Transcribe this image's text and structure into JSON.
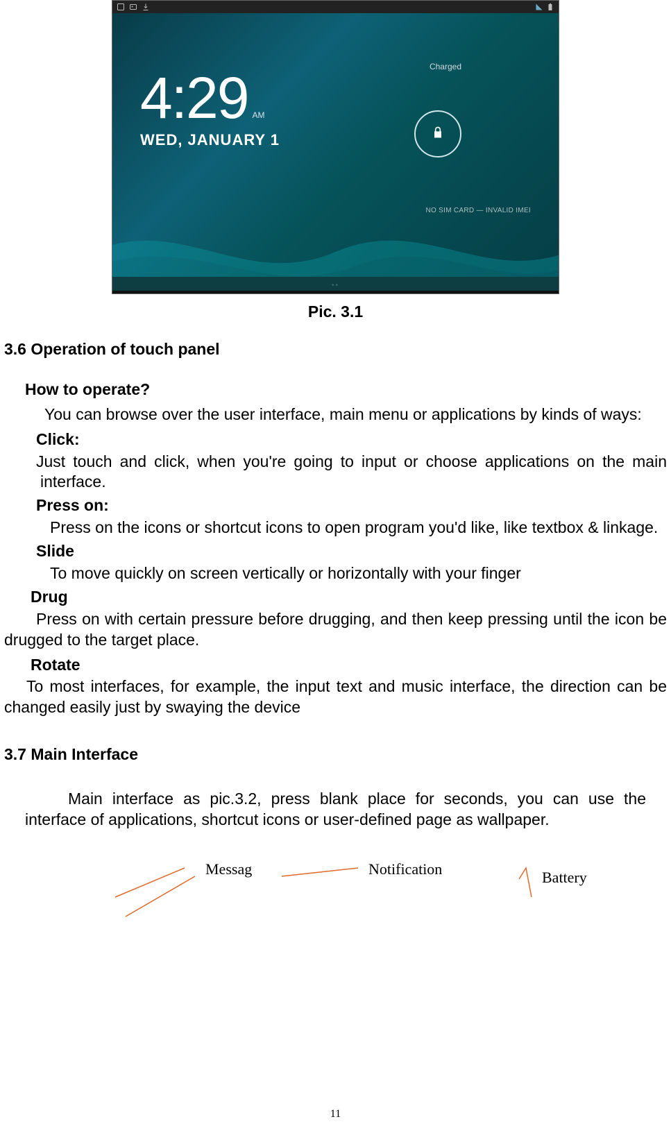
{
  "tablet": {
    "time": "4:29",
    "ampm": "AM",
    "date": "WED, JANUARY 1",
    "charged": "Charged",
    "sim_status": "NO SIM CARD — INVALID IMEI",
    "caption": "Pic. 3.1"
  },
  "section36": {
    "title": "3.6 Operation of touch panel",
    "howto": "How to operate?",
    "intro": "You can browse over the user interface, main menu or applications by kinds of ways:",
    "click_h": "Click:",
    "click_b": "Just touch and click, when you're going to input or choose applications on the main interface.",
    "press_h": "Press on:",
    "press_b": "Press on the icons or shortcut icons to open program you'd like, like textbox & linkage.",
    "slide_h": "Slide",
    "slide_b": "To move quickly on screen vertically or horizontally with your finger",
    "drug_h": "Drug",
    "drug_b": "Press on with certain pressure before drugging, and then keep pressing until the icon be drugged to the target place.",
    "rotate_h": "Rotate",
    "rotate_b": "To most interfaces, for example, the input text and music interface,  the direction can be changed easily just by swaying the device"
  },
  "section37": {
    "title": "3.7 Main Interface",
    "body": "Main interface as pic.3.2, press blank place for seconds, you can use the interface of applications, shortcut icons or user-defined page as wallpaper."
  },
  "callouts": {
    "messag": "Messag",
    "notification": "Notification",
    "battery": "Battery"
  },
  "page_number": "11"
}
